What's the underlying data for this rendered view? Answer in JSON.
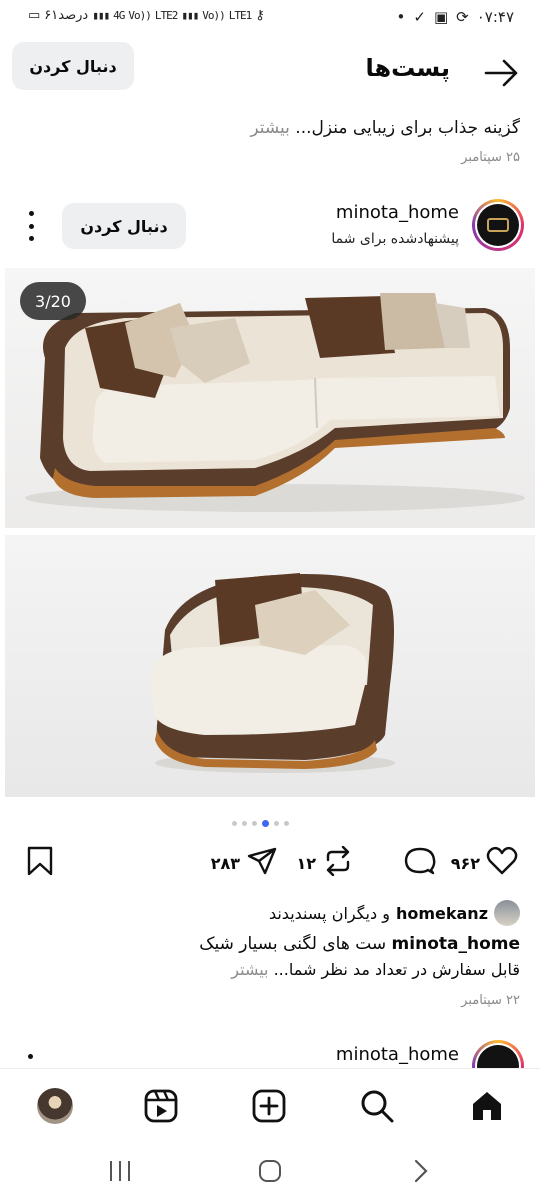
{
  "status_bar": {
    "time": "۰۷:۴۷",
    "battery": "۶۱درصد",
    "network1": "4G",
    "network2": "LTE2",
    "network3": "LTE1",
    "network1_label": "Vo))",
    "network2_label": "Vo))"
  },
  "header": {
    "title": "پست‌ها",
    "follow_label": "دنبال کردن"
  },
  "previous_post": {
    "caption": "گزینه جذاب برای زیبایی منزل...",
    "more": "بیشتر",
    "date": "۲۵ سپتامبر"
  },
  "post": {
    "username": "minota_home",
    "subtitle": "پیشنهادشده برای شما",
    "follow_label": "دنبال کردن",
    "counter": "3/20",
    "carousel": {
      "count": 6,
      "active_index": 3
    },
    "actions": {
      "likes": "۹۶۲",
      "comments": "",
      "reposts": "۱۲",
      "shares": "۲۸۳"
    },
    "liked_by": {
      "user": "homekanz",
      "text": "و دیگران پسندیدند"
    },
    "caption_user": "minota_home",
    "caption_line1": "ست های لگنی بسیار شیک",
    "caption_line2": "قابل سفارش در تعداد مد نظر شما...",
    "more": "بیشتر",
    "date": "۲۲ سپتامبر"
  },
  "next_post": {
    "username": "minota_home"
  },
  "bottom_nav": {
    "items": [
      "home-icon",
      "search-icon",
      "create-icon",
      "reels-icon",
      "profile"
    ]
  },
  "colors": {
    "accent": "#3f67f0",
    "button_bg": "#eeeff1",
    "muted_text": "#8a8a8a"
  }
}
